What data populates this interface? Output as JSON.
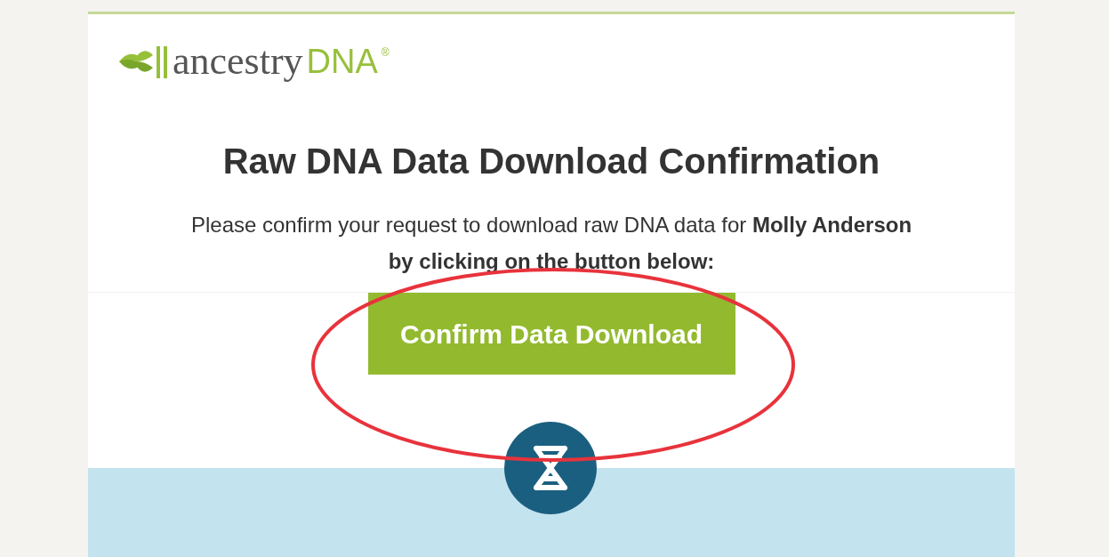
{
  "brand": {
    "name": "ancestry",
    "suffix": "DNA",
    "mark": "®"
  },
  "title": "Raw DNA Data Download Confirmation",
  "message": "Please confirm your request to download raw DNA data for **Molly Anderson by clicking on the button below:**",
  "button": {
    "label": "Confirm Data Download"
  },
  "annotation": {
    "kind": "ellipse",
    "color": "#e8333c"
  }
}
